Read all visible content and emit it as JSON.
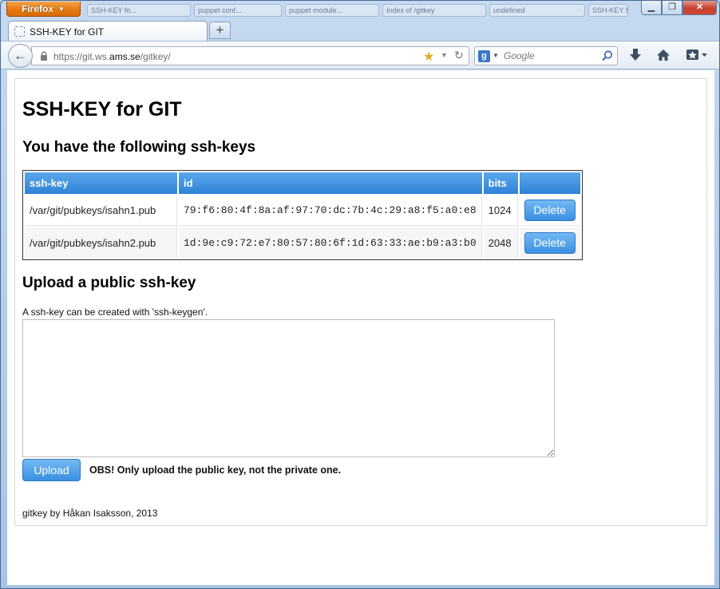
{
  "browser": {
    "menu_button": "Firefox",
    "background_tabs": [
      "SSH-KEY fo...",
      "puppet conf...",
      "puppet module...",
      "Index of /gitkey",
      "undefined",
      "SSH-KEY for..."
    ],
    "active_tab": {
      "title": "SSH-KEY for GIT"
    },
    "url": {
      "prefix": "https://git.ws.",
      "domain": "ams.se",
      "path": "/gitkey/"
    },
    "search": {
      "engine": "Google",
      "placeholder": "Google"
    },
    "window_controls": [
      "minimize",
      "restore",
      "close"
    ],
    "icons": [
      "back-icon",
      "lock-icon",
      "star-icon",
      "reload-icon",
      "google-icon",
      "search-icon",
      "download-icon",
      "home-icon",
      "bookmarks-icon"
    ]
  },
  "page": {
    "title": "SSH-KEY for GIT",
    "keys_heading": "You have the following ssh-keys",
    "table": {
      "headers": [
        "ssh-key",
        "id",
        "bits",
        ""
      ],
      "rows": [
        {
          "path": "/var/git/pubkeys/isahn1.pub",
          "id": "79:f6:80:4f:8a:af:97:70:dc:7b:4c:29:a8:f5:a0:e8",
          "bits": "1024",
          "action": "Delete"
        },
        {
          "path": "/var/git/pubkeys/isahn2.pub",
          "id": "1d:9e:c9:72:e7:80:57:80:6f:1d:63:33:ae:b9:a3:b0",
          "bits": "2048",
          "action": "Delete"
        }
      ]
    },
    "upload_heading": "Upload a public ssh-key",
    "hint": "A ssh-key can be created with 'ssh-keygen'.",
    "textarea_value": "",
    "upload_button": "Upload",
    "obs_note": "OBS! Only upload the public key, not the private one.",
    "footer": "gitkey by Håkan Isaksson, 2013"
  },
  "colors": {
    "header_blue": "#2f82d6",
    "button_blue": "#3a8fe3",
    "firefox_orange": "#e57a10",
    "window_frame": "#a8c4e4"
  }
}
